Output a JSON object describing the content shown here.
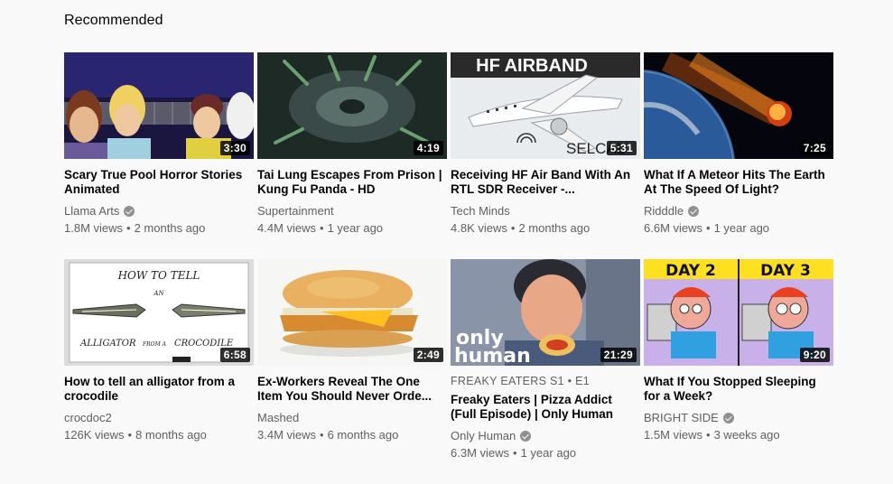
{
  "section": {
    "title": "Recommended"
  },
  "icons": {
    "verified": "check-circle-icon"
  },
  "videos": [
    {
      "title": "Scary True Pool Horror Stories Animated",
      "channel": "Llama Arts",
      "verified": true,
      "views": "1.8M views",
      "age": "2 months ago",
      "duration": "3:30"
    },
    {
      "title": "Tai Lung Escapes From Prison | Kung Fu Panda - HD",
      "channel": "Supertainment",
      "verified": false,
      "views": "4.4M views",
      "age": "1 year ago",
      "duration": "4:19"
    },
    {
      "title": "Receiving HF Air Band With An RTL SDR Receiver -...",
      "channel": "Tech Minds",
      "verified": false,
      "views": "4.8K views",
      "age": "2 months ago",
      "duration": "5:31",
      "thumb_text": "HF AIRBAND",
      "thumb_text2": "SELCAL"
    },
    {
      "title": "What If A Meteor Hits The Earth At The Speed Of Light?",
      "channel": "Ridddle",
      "verified": true,
      "views": "6.6M views",
      "age": "1 year ago",
      "duration": "7:25"
    },
    {
      "title": "How to tell an alligator from a crocodile",
      "channel": "crocdoc2",
      "verified": false,
      "views": "126K views",
      "age": "8 months ago",
      "duration": "6:58",
      "thumb_text": "HOW TO TELL",
      "thumb_text2": "AN",
      "thumb_text3": "ALLIGATOR",
      "thumb_text4": "FROM A",
      "thumb_text5": "CROCODILE"
    },
    {
      "title": "Ex-Workers Reveal The One Item You Should Never Orde...",
      "channel": "Mashed",
      "verified": false,
      "views": "3.4M views",
      "age": "6 months ago",
      "duration": "2:49"
    },
    {
      "series": "FREAKY EATERS  S1 • E1",
      "title": "Freaky Eaters | Pizza Addict (Full Episode) | Only Human",
      "channel": "Only Human",
      "verified": true,
      "views": "6.3M views",
      "age": "1 year ago",
      "duration": "21:29",
      "thumb_text": "only",
      "thumb_text2": "human"
    },
    {
      "title": "What If You Stopped Sleeping for a Week?",
      "channel": "BRIGHT SIDE",
      "verified": true,
      "views": "1.5M views",
      "age": "3 weeks ago",
      "duration": "9:20",
      "thumb_text": "DAY 2",
      "thumb_text2": "DAY 3"
    }
  ]
}
